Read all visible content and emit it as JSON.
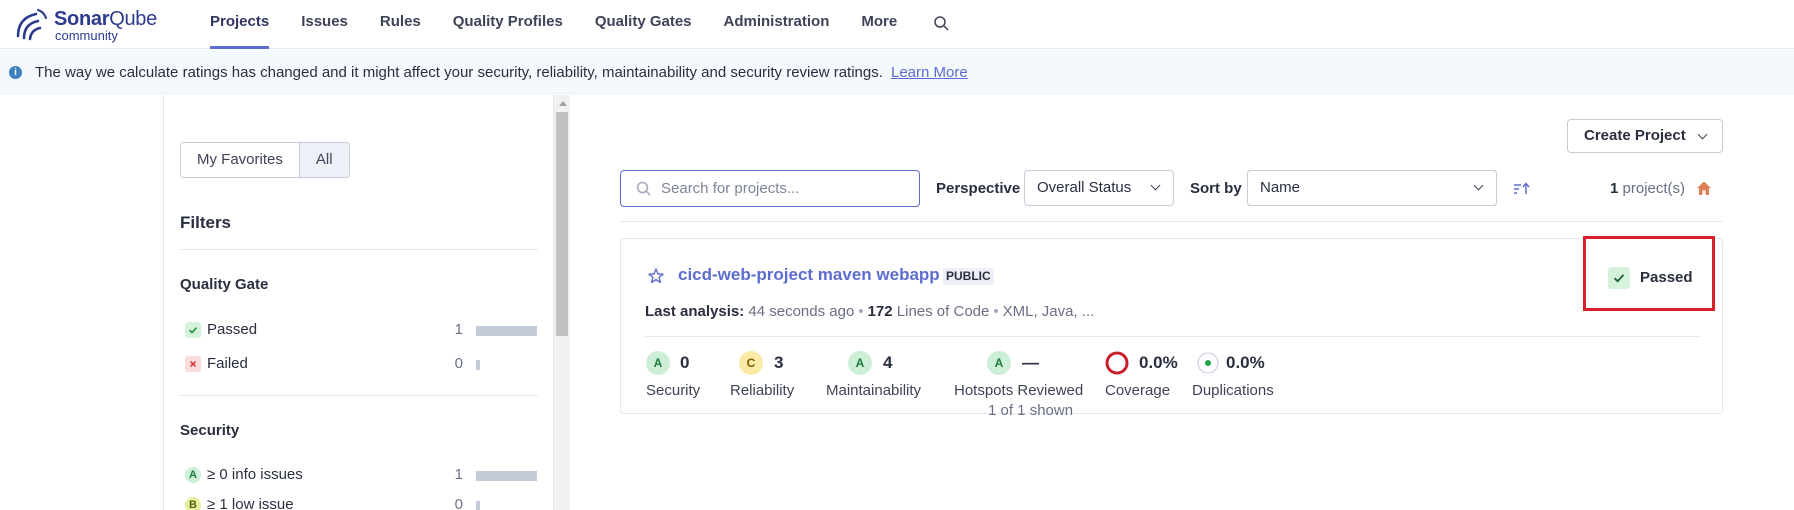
{
  "brand": {
    "name_part1": "Sonar",
    "name_part2": "Qube",
    "edition": "community"
  },
  "nav": {
    "items": [
      {
        "label": "Projects",
        "active": true
      },
      {
        "label": "Issues"
      },
      {
        "label": "Rules"
      },
      {
        "label": "Quality Profiles"
      },
      {
        "label": "Quality Gates"
      },
      {
        "label": "Administration"
      },
      {
        "label": "More"
      }
    ]
  },
  "banner": {
    "text": "The way we calculate ratings has changed and it might affect your security, reliability, maintainability and security review ratings.",
    "link": "Learn More"
  },
  "sidebar": {
    "toggle": {
      "favorites": "My Favorites",
      "all": "All"
    },
    "filters_title": "Filters",
    "quality_gate": {
      "title": "Quality Gate",
      "rows": [
        {
          "label": "Passed",
          "count": "1",
          "icon": "check-icon"
        },
        {
          "label": "Failed",
          "count": "0",
          "icon": "x-icon"
        }
      ]
    },
    "security": {
      "title": "Security",
      "rows": [
        {
          "rating": "A",
          "label": "≥ 0 info issues",
          "count": "1"
        },
        {
          "rating": "B",
          "label": "≥ 1 low issue",
          "count": "0"
        }
      ]
    }
  },
  "toolbar": {
    "create_project": "Create Project",
    "search_placeholder": "Search for projects...",
    "perspective_label": "Perspective",
    "perspective_value": "Overall Status",
    "sort_label": "Sort by",
    "sort_value": "Name",
    "count_number": "1",
    "count_suffix": "project(s)"
  },
  "project": {
    "name": "cicd-web-project maven webapp",
    "visibility": "PUBLIC",
    "quality_gate": "Passed",
    "last_analysis_label": "Last analysis:",
    "last_analysis_value": "44 seconds ago",
    "loc_value": "172",
    "loc_label": "Lines of Code",
    "languages": "XML, Java, ...",
    "metrics": [
      {
        "rating": "A",
        "value": "0",
        "label": "Security"
      },
      {
        "rating": "C",
        "value": "3",
        "label": "Reliability"
      },
      {
        "rating": "A",
        "value": "4",
        "label": "Maintainability"
      },
      {
        "rating": "A",
        "value": "—",
        "label": "Hotspots Reviewed"
      },
      {
        "value": "0.0%",
        "label": "Coverage"
      },
      {
        "value": "0.0%",
        "label": "Duplications"
      }
    ]
  },
  "footer": {
    "shown": "1 of 1 shown"
  },
  "colors": {
    "accent": "#5d6cd0",
    "highlight": "#d9202a",
    "coverage_ring": "#c8202a"
  }
}
